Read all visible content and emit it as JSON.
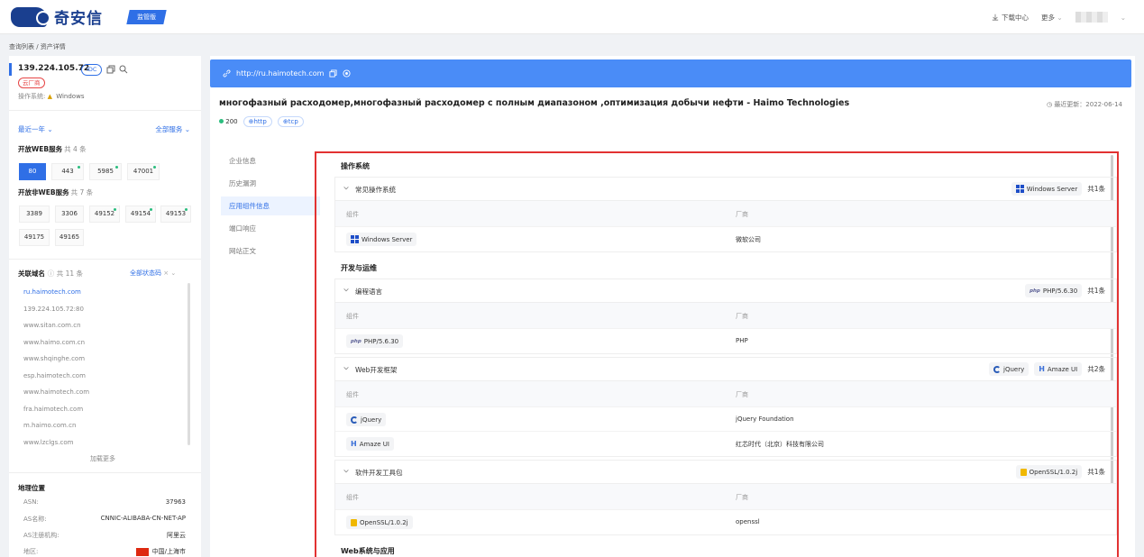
{
  "header": {
    "brand": "奇安信",
    "edition": "监管版",
    "download": "下载中心",
    "more": "更多"
  },
  "breadcrumb": "查询列表 / 资产详情",
  "asset": {
    "ip": "139.224.105.72",
    "idc_tag": "IDC",
    "cloud_tag": "云厂商",
    "os_label": "操作系统:",
    "os_value": "Windows",
    "time_range": "最近一年",
    "service_filter": "全部服务",
    "web_services_title": "开放WEB服务",
    "web_services_count": "共 4 条",
    "web_ports": [
      {
        "port": "80",
        "active": true,
        "new": false
      },
      {
        "port": "443",
        "active": false,
        "new": true
      },
      {
        "port": "5985",
        "active": false,
        "new": true
      },
      {
        "port": "47001",
        "active": false,
        "new": true
      }
    ],
    "nonweb_services_title": "开放非WEB服务",
    "nonweb_services_count": "共 7 条",
    "nonweb_ports": [
      {
        "port": "3389",
        "new": false
      },
      {
        "port": "3306",
        "new": false
      },
      {
        "port": "49152",
        "new": true
      },
      {
        "port": "49154",
        "new": true
      },
      {
        "port": "49153",
        "new": true
      },
      {
        "port": "49175",
        "new": false
      },
      {
        "port": "49165",
        "new": false
      }
    ],
    "domains_title": "关联域名",
    "domains_count": "共 11 条",
    "domains_status": "全部状态码",
    "domains": [
      "ru.haimotech.com",
      "139.224.105.72:80",
      "www.sitan.com.cn",
      "www.haimo.com.cn",
      "www.shqinghe.com",
      "esp.haimotech.com",
      "www.haimotech.com",
      "fra.haimotech.com",
      "m.haimo.com.cn",
      "www.lzclgs.com"
    ],
    "load_more": "加载更多",
    "geo_title": "地理位置",
    "geo": [
      {
        "k": "ASN:",
        "v": "37963"
      },
      {
        "k": "AS名称:",
        "v": "CNNIC-ALIBABA-CN-NET-AP"
      },
      {
        "k": "AS注册机构:",
        "v": "阿里云"
      },
      {
        "k": "地区:",
        "v": "中国/上海市"
      }
    ]
  },
  "site": {
    "url": "http://ru.haimotech.com",
    "title": "многофазный расходомер,многофазный расходомер с полным диапазоном ,оптимизация добычи нефти - Haimo Technologies",
    "last_update": "最近更新：2022-06-14",
    "status_code": "200",
    "protocols": [
      "http",
      "tcp"
    ]
  },
  "tabs": [
    "企业信息",
    "历史漏洞",
    "应用组件信息",
    "端口响应",
    "网站正文"
  ],
  "active_tab": 2,
  "components": {
    "col_component": "组件",
    "col_vendor": "厂商",
    "categories": [
      {
        "title": "操作系统",
        "groups": [
          {
            "name": "常见操作系统",
            "count": "共1条",
            "rows": [
              {
                "component": "Windows Server",
                "icon": "windows-icon",
                "vendor": "微软公司"
              }
            ]
          }
        ]
      },
      {
        "title": "开发与运维",
        "groups": [
          {
            "name": "编程语言",
            "count": "共1条",
            "rows": [
              {
                "component": "PHP/5.6.30",
                "icon": "php-icon",
                "vendor": "PHP"
              }
            ]
          },
          {
            "name": "Web开发框架",
            "count": "共2条",
            "rows": [
              {
                "component": "jQuery",
                "icon": "jquery-icon",
                "vendor": "jQuery Foundation"
              },
              {
                "component": "Amaze UI",
                "icon": "amaze-ui-icon",
                "vendor": "红芯时代（北京）科技有限公司"
              }
            ]
          },
          {
            "name": "软件开发工具包",
            "count": "共1条",
            "rows": [
              {
                "component": "OpenSSL/1.0.2j",
                "icon": "openssl-icon",
                "vendor": "openssl"
              }
            ]
          }
        ]
      },
      {
        "title": "Web系统与应用",
        "groups": []
      }
    ]
  },
  "colors": {
    "accent": "#2f6fe6",
    "url_bar": "#4a8cf7",
    "highlight_border": "#e23232",
    "new_dot": "#2bbd7e"
  }
}
